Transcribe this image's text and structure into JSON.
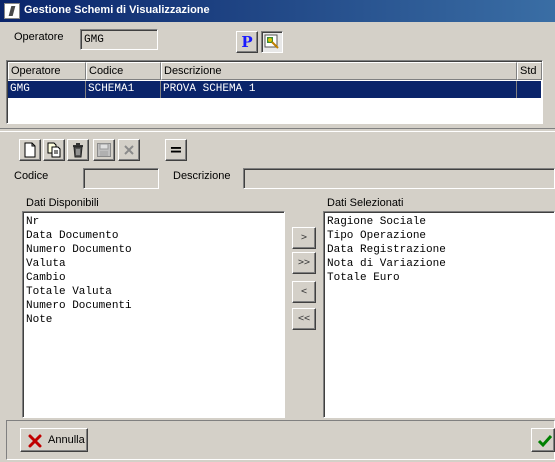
{
  "window": {
    "title": "Gestione Schemi di Visualizzazione"
  },
  "operator": {
    "label": "Operatore",
    "value": "GMG"
  },
  "toolbar_top": {
    "p_label": "P"
  },
  "grid": {
    "headers": [
      "Operatore",
      "Codice",
      "Descrizione",
      "Std"
    ],
    "rows": [
      {
        "operatore": "GMG",
        "codice": "SCHEMA1",
        "descrizione": "PROVA SCHEMA 1",
        "std": ""
      }
    ]
  },
  "edit_toolbar": {
    "equals_label": "="
  },
  "form": {
    "codice_label": "Codice",
    "codice_value": "",
    "descrizione_label": "Descrizione",
    "descrizione_value": ""
  },
  "available": {
    "title": "Dati Disponibili",
    "items": [
      "Nr",
      "Data Documento",
      "Numero Documento",
      "Valuta",
      "Cambio",
      "Totale Valuta",
      "Numero Documenti",
      "Note"
    ]
  },
  "selected": {
    "title": "Dati Selezionati",
    "items": [
      "Ragione Sociale",
      "Tipo Operazione",
      "Data Registrazione",
      "Nota di Variazione",
      "Totale Euro"
    ]
  },
  "move_buttons": {
    "add_one": ">",
    "add_all": ">>",
    "remove_one": "<",
    "remove_all": "<<"
  },
  "footer": {
    "cancel_label": "Annulla"
  },
  "colors": {
    "title_gradient_start": "#0a246a",
    "title_gradient_end": "#3a6ea5",
    "selection": "#0a246a",
    "face": "#d4d0c8"
  }
}
